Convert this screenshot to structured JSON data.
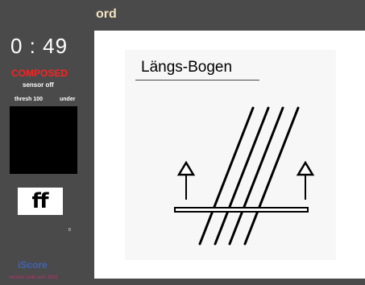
{
  "sidebar": {
    "timer": "0 : 49",
    "mode": "COMPOSED",
    "sensor_status": "sensor off",
    "thresh": "thresh 100",
    "under": "under",
    "dynamic": "ff",
    "counter": "0",
    "brand": "iScore",
    "version": "version cello solo 2011"
  },
  "header": {
    "technique": "ord"
  },
  "main": {
    "instruction_title": "Längs-Bogen"
  },
  "colors": {
    "background": "#4a4a4a",
    "mode_red": "#ff2020",
    "technique_cream": "#f1e2bf",
    "brand_blue": "#3f64b9",
    "version_pink": "#c0306a"
  },
  "icons": {
    "left_arrow": "up-arrow-icon",
    "right_arrow": "up-arrow-icon",
    "strings": "cello-strings-icon",
    "bow": "bow-icon"
  }
}
